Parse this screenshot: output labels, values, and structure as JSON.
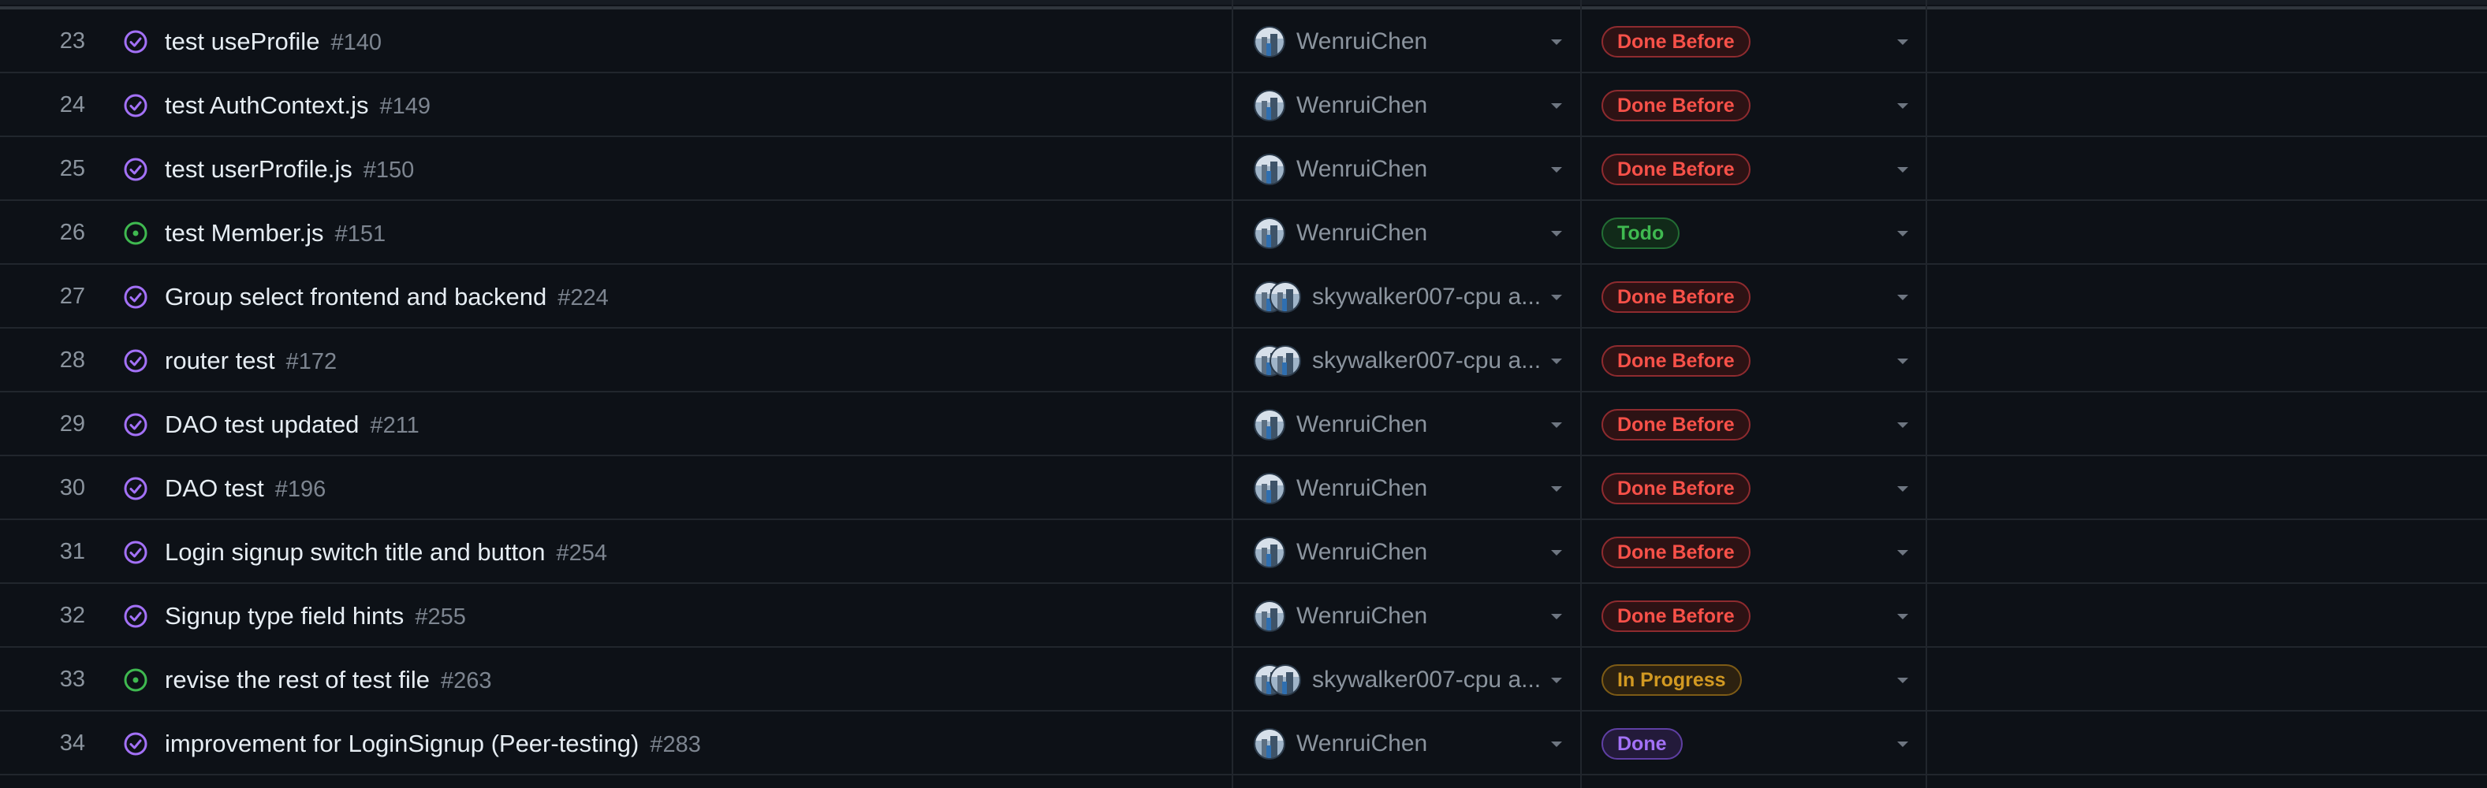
{
  "colors": {
    "closed_icon": "#a371f7",
    "open_icon": "#3fb950",
    "done_before": "#f85149",
    "todo": "#3fb950",
    "in_progress": "#d29922",
    "done": "#a371f7"
  },
  "rows": [
    {
      "num": "23",
      "title": "test useProfile",
      "issue": "#140",
      "state_icon": "closed-check-icon",
      "assignee": "WenruiChen",
      "multi": false,
      "status": "Done Before",
      "status_kind": "done-before"
    },
    {
      "num": "24",
      "title": "test AuthContext.js",
      "issue": "#149",
      "state_icon": "closed-check-icon",
      "assignee": "WenruiChen",
      "multi": false,
      "status": "Done Before",
      "status_kind": "done-before"
    },
    {
      "num": "25",
      "title": "test userProfile.js",
      "issue": "#150",
      "state_icon": "closed-check-icon",
      "assignee": "WenruiChen",
      "multi": false,
      "status": "Done Before",
      "status_kind": "done-before"
    },
    {
      "num": "26",
      "title": "test Member.js",
      "issue": "#151",
      "state_icon": "open-issue-icon",
      "assignee": "WenruiChen",
      "multi": false,
      "status": "Todo",
      "status_kind": "todo"
    },
    {
      "num": "27",
      "title": "Group select frontend and backend",
      "issue": "#224",
      "state_icon": "closed-check-icon",
      "assignee": "skywalker007-cpu a...",
      "multi": true,
      "status": "Done Before",
      "status_kind": "done-before"
    },
    {
      "num": "28",
      "title": "router test",
      "issue": "#172",
      "state_icon": "closed-check-icon",
      "assignee": "skywalker007-cpu a...",
      "multi": true,
      "status": "Done Before",
      "status_kind": "done-before"
    },
    {
      "num": "29",
      "title": "DAO test updated",
      "issue": "#211",
      "state_icon": "closed-check-icon",
      "assignee": "WenruiChen",
      "multi": false,
      "status": "Done Before",
      "status_kind": "done-before"
    },
    {
      "num": "30",
      "title": "DAO test",
      "issue": "#196",
      "state_icon": "closed-check-icon",
      "assignee": "WenruiChen",
      "multi": false,
      "status": "Done Before",
      "status_kind": "done-before"
    },
    {
      "num": "31",
      "title": "Login signup switch title and button",
      "issue": "#254",
      "state_icon": "closed-check-icon",
      "assignee": "WenruiChen",
      "multi": false,
      "status": "Done Before",
      "status_kind": "done-before"
    },
    {
      "num": "32",
      "title": "Signup type field hints",
      "issue": "#255",
      "state_icon": "closed-check-icon",
      "assignee": "WenruiChen",
      "multi": false,
      "status": "Done Before",
      "status_kind": "done-before"
    },
    {
      "num": "33",
      "title": "revise the rest of test file",
      "issue": "#263",
      "state_icon": "open-issue-icon",
      "assignee": "skywalker007-cpu a...",
      "multi": true,
      "status": "In Progress",
      "status_kind": "in-progress"
    },
    {
      "num": "34",
      "title": "improvement for LoginSignup (Peer-testing)",
      "issue": "#283",
      "state_icon": "closed-check-icon",
      "assignee": "WenruiChen",
      "multi": false,
      "status": "Done",
      "status_kind": "done"
    }
  ]
}
